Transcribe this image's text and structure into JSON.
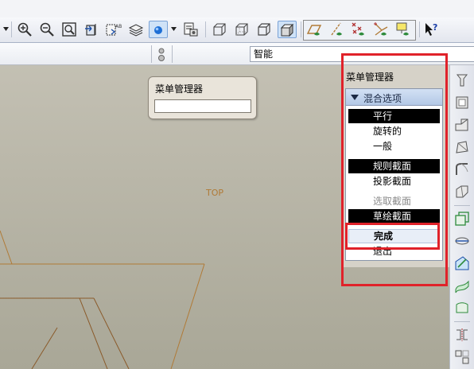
{
  "filter": {
    "value": "智能"
  },
  "float_menu": {
    "title": "菜单管理器"
  },
  "menu_manager": {
    "title": "菜单管理器",
    "section": "混合选项",
    "items": [
      {
        "label": "平行",
        "state": "selected"
      },
      {
        "label": "旋转的",
        "state": "normal"
      },
      {
        "label": "一般",
        "state": "normal"
      },
      {
        "label": "规则截面",
        "state": "selected"
      },
      {
        "label": "投影截面",
        "state": "normal"
      },
      {
        "label": "选取截面",
        "state": "disabled"
      },
      {
        "label": "草绘截面",
        "state": "selected"
      },
      {
        "label": "完成",
        "state": "hover"
      },
      {
        "label": "退出",
        "state": "normal"
      }
    ]
  },
  "viewport": {
    "datum_label": "TOP"
  },
  "colors": {
    "highlight": "#e0222a",
    "datum_line": "#b07a36",
    "accent": "#1e6fd6"
  }
}
